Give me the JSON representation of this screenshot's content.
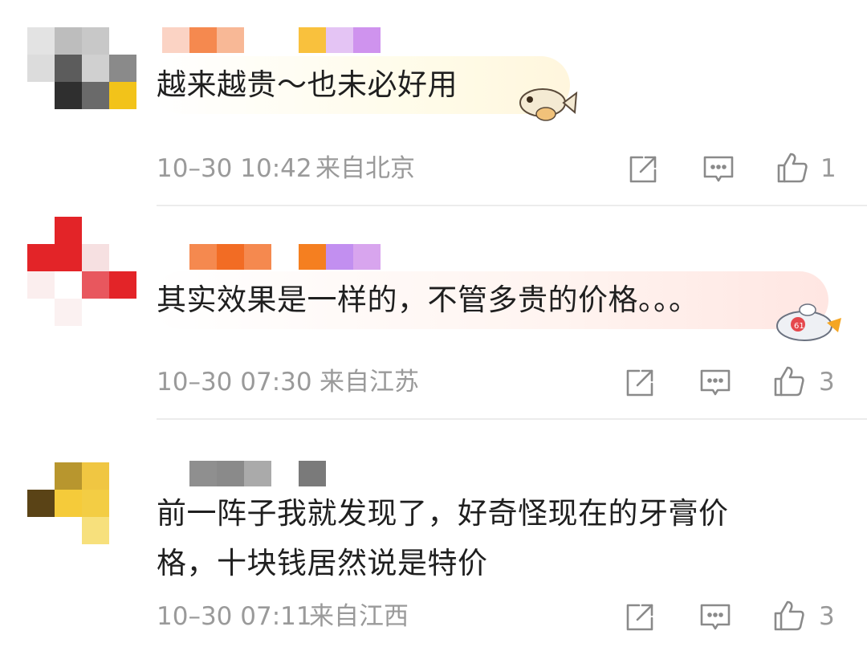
{
  "comments": [
    {
      "lines": [
        "越来越贵～也未必好用"
      ],
      "time": "10–30 10:42",
      "location": "来自北京",
      "likes": "1",
      "sticker": "fish-sticker"
    },
    {
      "lines": [
        "其实效果是一样的，不管多贵的价格。。。"
      ],
      "time": "10–30 07:30",
      "location": "来自江苏",
      "likes": "3",
      "sticker": "robot-bee-sticker"
    },
    {
      "lines": [
        "前一阵子我就发现了，好奇怪现在的牙膏价",
        "格，十块钱居然说是特价"
      ],
      "time": "10–30 07:11",
      "location": "来自江西",
      "likes": "3",
      "sticker": ""
    }
  ],
  "icons": {
    "share": "share-icon",
    "reply": "comment-icon",
    "like": "thumbs-up-icon"
  },
  "colors": {
    "text": "#1f1f1f",
    "meta": "#9a9a9a",
    "divider": "#ececec"
  }
}
